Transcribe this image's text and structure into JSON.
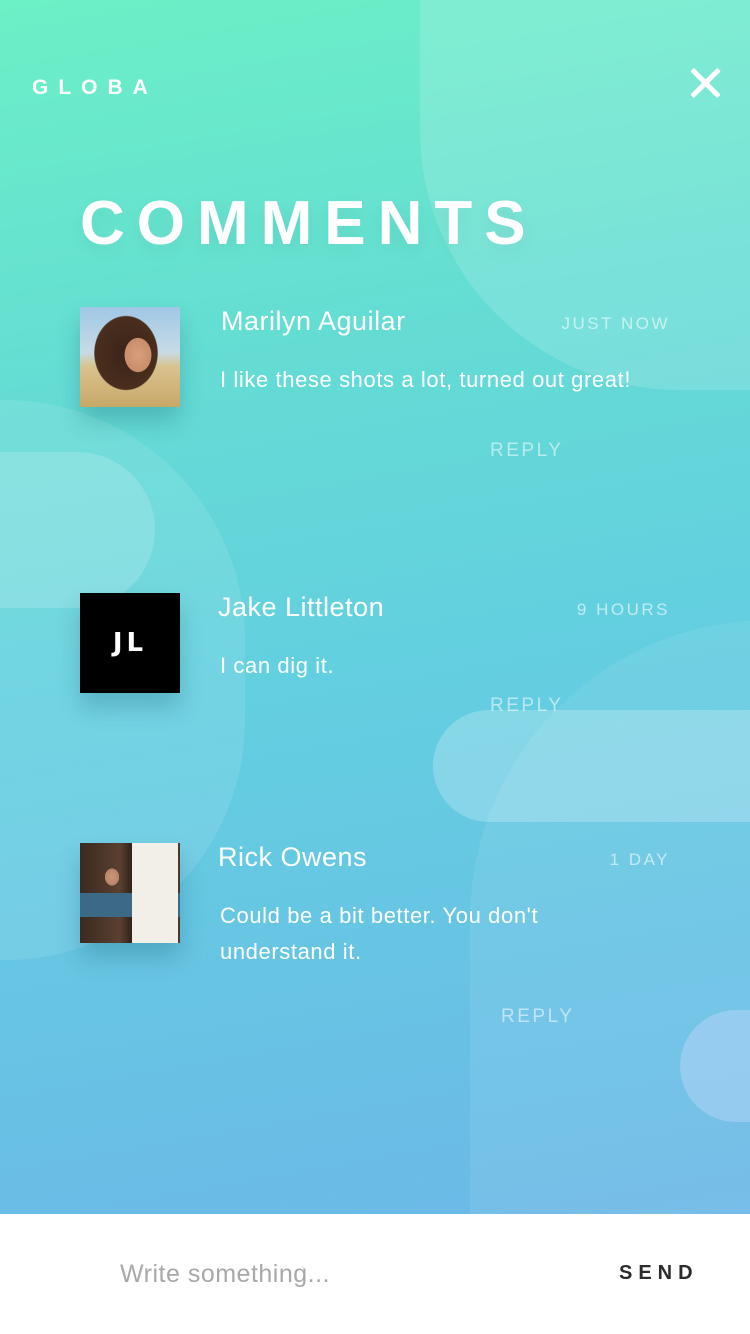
{
  "app": {
    "brand": "GLOBA",
    "close_icon": "close-icon"
  },
  "page": {
    "title": "COMMENTS"
  },
  "comments": [
    {
      "author": "Marilyn Aguilar",
      "time": "JUST NOW",
      "text": "I like these shots a lot, turned out great!",
      "reply_label": "REPLY",
      "avatar": {
        "type": "photo"
      }
    },
    {
      "author": "Jake Littleton",
      "time": "9 HOURS",
      "text": "I can dig it.",
      "reply_label": "REPLY",
      "avatar": {
        "type": "initials",
        "initials": "JL"
      }
    },
    {
      "author": "Rick Owens",
      "time": "1 DAY",
      "text": "Could be a bit better. You don't understand it.",
      "reply_label": "REPLY",
      "avatar": {
        "type": "photo"
      }
    }
  ],
  "composer": {
    "placeholder": "Write something...",
    "value": "",
    "send_label": "SEND"
  },
  "colors": {
    "gradient_top": "#6cf0c6",
    "gradient_bottom": "#6cb8e8",
    "accent_text": "#ffffff",
    "send_text": "#2b2b2b"
  }
}
